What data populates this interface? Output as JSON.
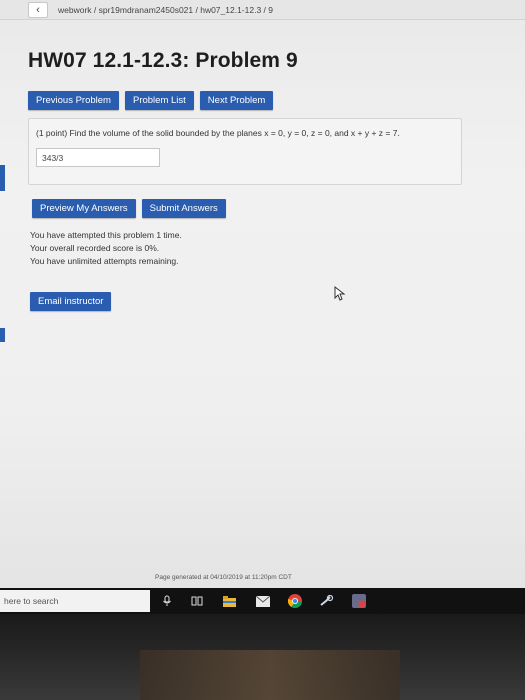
{
  "breadcrumb": "webwork / spr19mdranam2450s021 / hw07_12.1-12.3 / 9",
  "page_title": "HW07 12.1-12.3: Problem 9",
  "nav": {
    "previous": "Previous Problem",
    "list": "Problem List",
    "next": "Next Problem"
  },
  "problem": {
    "text": "(1 point) Find the volume of the solid bounded by the planes x = 0, y = 0, z = 0, and x + y + z = 7.",
    "answer": "343/3"
  },
  "actions": {
    "preview": "Preview My Answers",
    "submit": "Submit Answers"
  },
  "status": {
    "line1": "You have attempted this problem 1 time.",
    "line2": "Your overall recorded score is 0%.",
    "line3": "You have unlimited attempts remaining."
  },
  "email_label": "Email instructor",
  "footer": "Page generated at 04/10/2019 at 11:20pm CDT",
  "taskbar": {
    "search": "here to search"
  },
  "icons": [
    "back-icon",
    "cursor-icon",
    "microphone-icon",
    "task-view-icon",
    "file-explorer-icon",
    "mail-icon",
    "chrome-icon",
    "steam-icon",
    "app-icon"
  ],
  "colors": {
    "accent": "#2a5db0"
  }
}
